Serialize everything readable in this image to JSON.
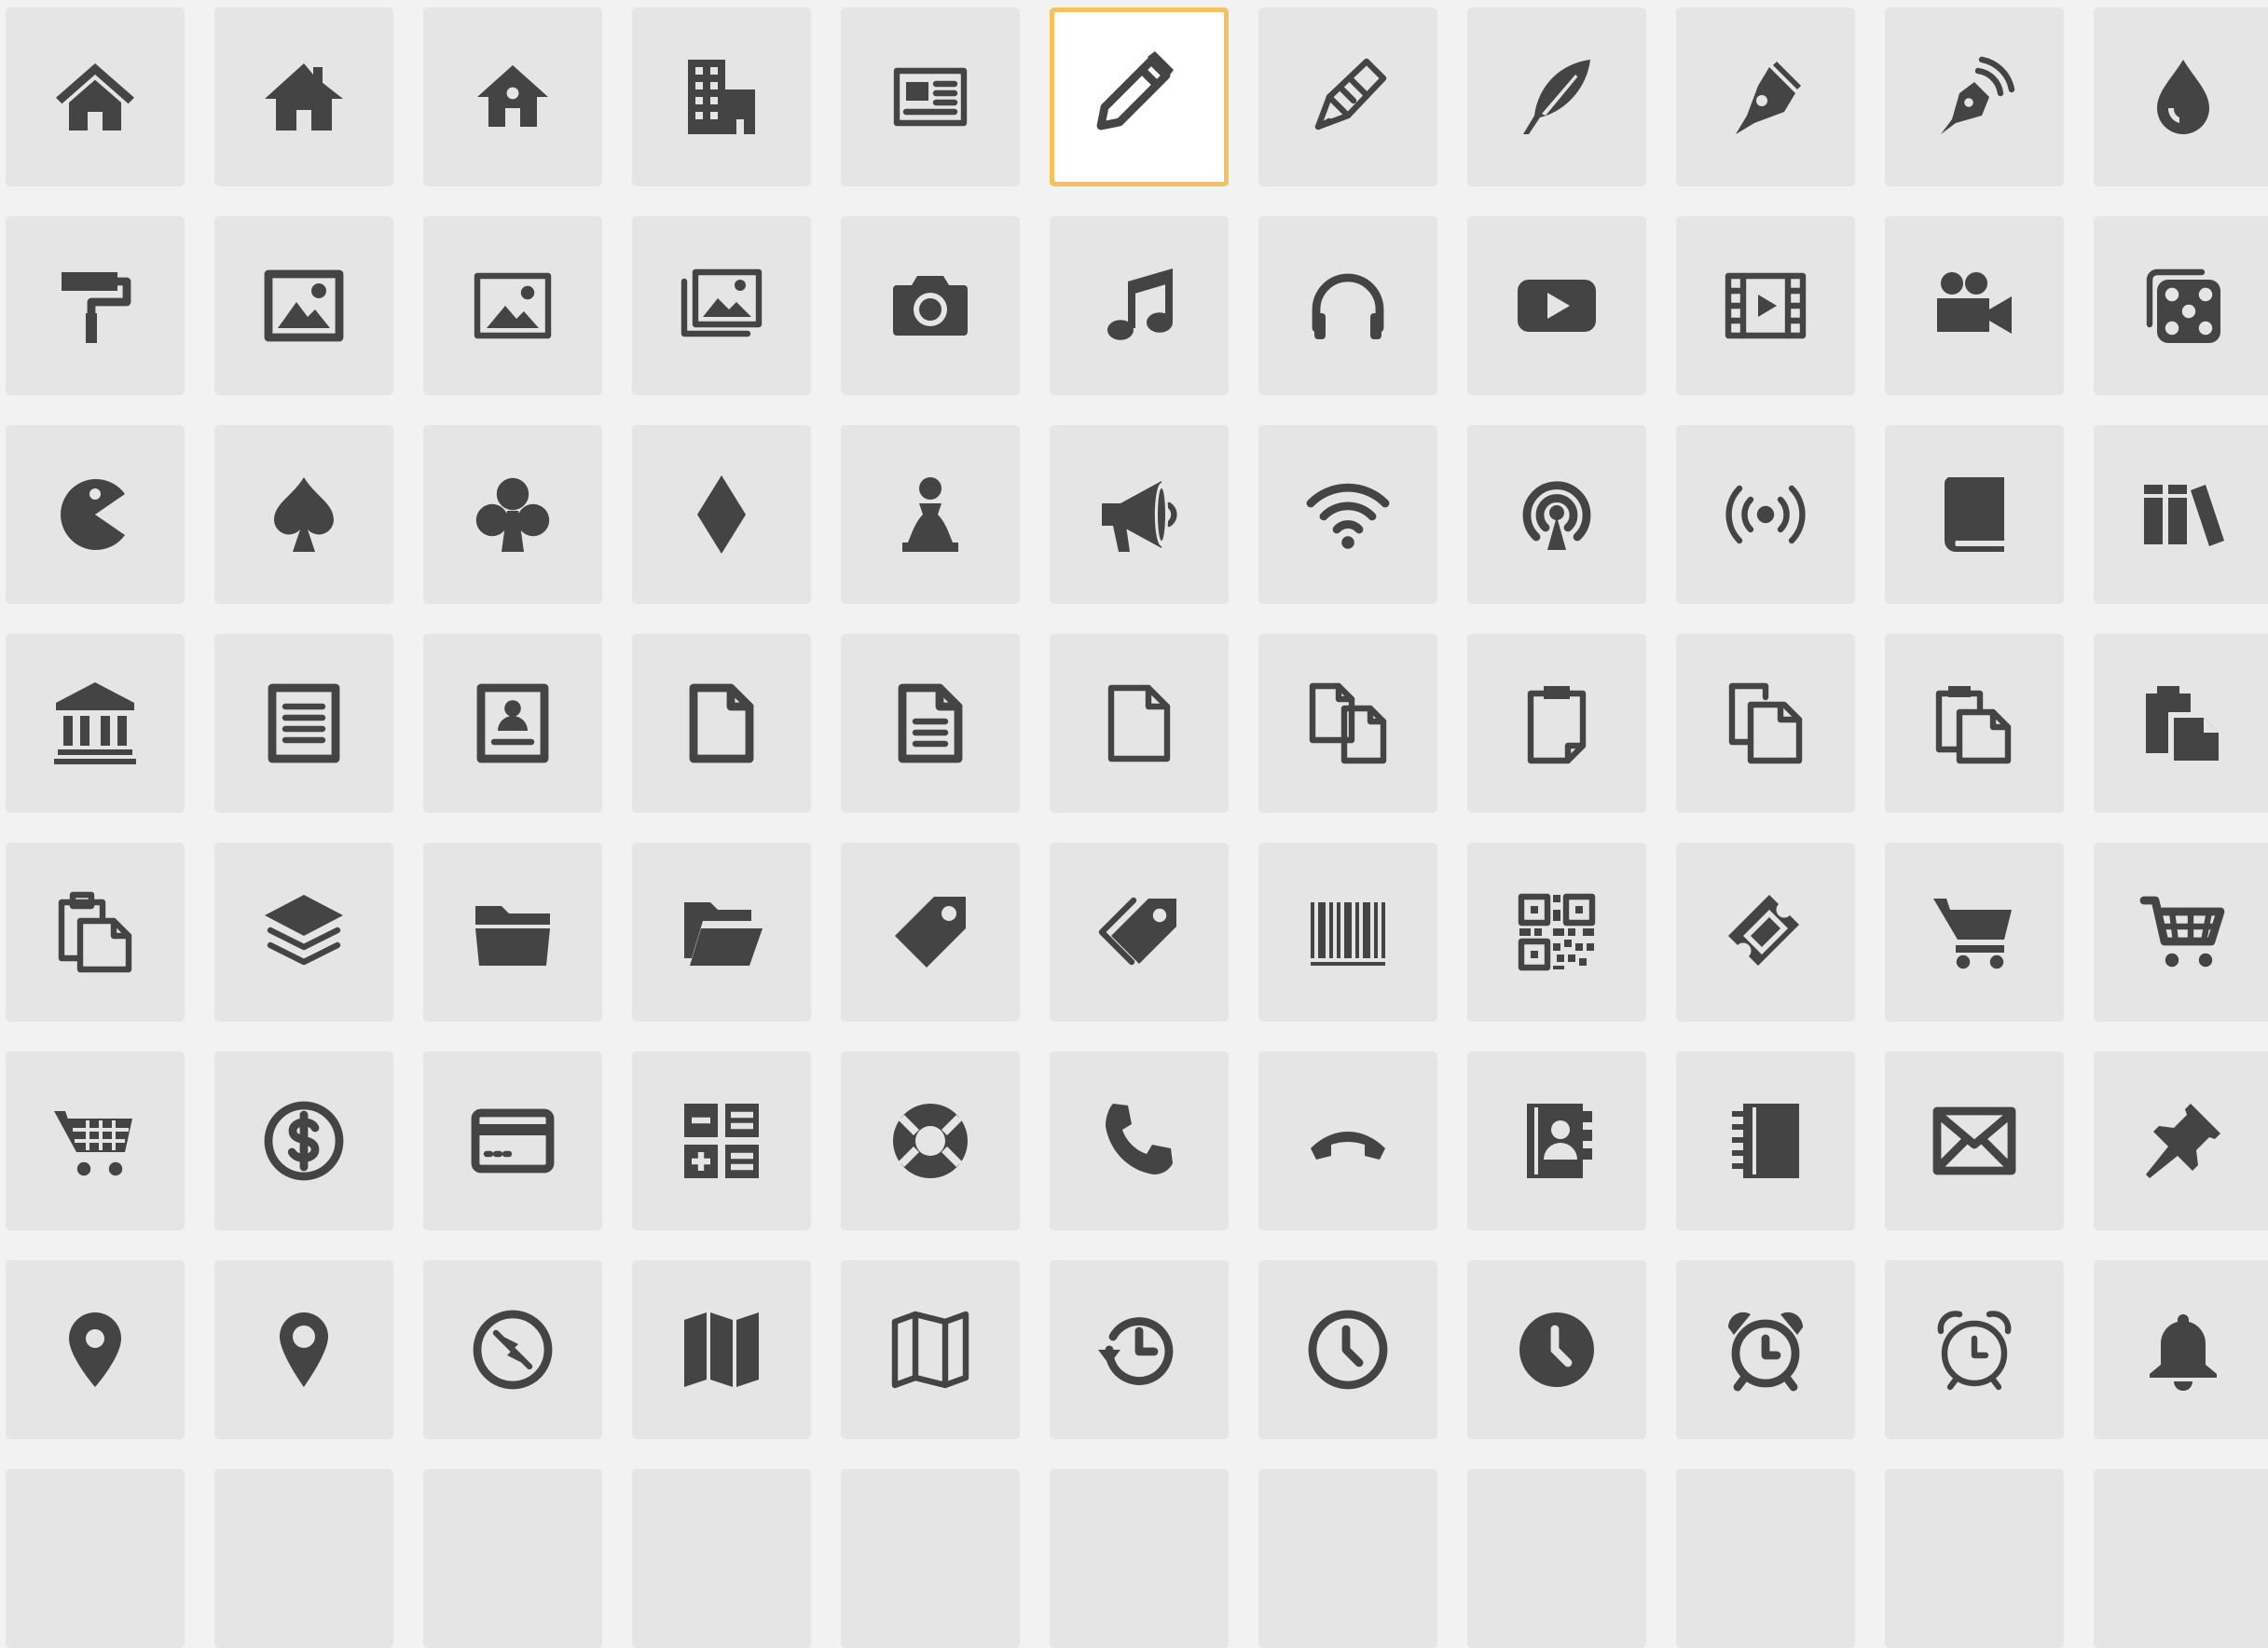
{
  "colors": {
    "page_background": "#f2f2f2",
    "tile_background": "#e5e5e5",
    "icon": "#444444",
    "selected_border": "#f6c25e"
  },
  "selected_icon": "pencil-icon",
  "icons": [
    [
      "home-icon",
      "home-solid-icon",
      "home-small-icon",
      "office-icon",
      "newspaper-icon",
      "pencil-icon",
      "quill-pencil-icon",
      "feather-icon",
      "pen-icon",
      "blog-icon",
      "droplet-icon"
    ],
    [
      "paint-roller-icon",
      "image-icon",
      "image-outline-icon",
      "images-icon",
      "camera-icon",
      "music-icon",
      "headphones-icon",
      "play-icon",
      "film-icon",
      "video-camera-icon",
      "dice-icon"
    ],
    [
      "pacman-icon",
      "spades-icon",
      "clubs-icon",
      "diamonds-icon",
      "pawn-icon",
      "bullhorn-icon",
      "wifi-icon",
      "podcast-icon",
      "feed-icon",
      "book-icon",
      "books-icon"
    ],
    [
      "library-icon",
      "file-text-icon",
      "profile-icon",
      "file-empty-icon",
      "file-text2-icon",
      "file-outline-icon",
      "files-empty-icon",
      "clipboard-file-icon",
      "copy-icon",
      "paste-icon",
      "paste-solid-icon"
    ],
    [
      "paste-outline-icon",
      "stack-icon",
      "folder-icon",
      "folder-open-icon",
      "price-tag-icon",
      "price-tags-icon",
      "barcode-icon",
      "qrcode-icon",
      "ticket-icon",
      "cart-icon",
      "cart-outline-icon"
    ],
    [
      "shopping-basket-icon",
      "coin-dollar-icon",
      "credit-card-icon",
      "calculator-icon",
      "lifebuoy-icon",
      "phone-icon",
      "phone-hang-up-icon",
      "address-book-icon",
      "notebook-icon",
      "envelop-icon",
      "pushpin-icon"
    ],
    [
      "location-icon",
      "location2-icon",
      "compass-icon",
      "map-icon",
      "map-outline-icon",
      "history-icon",
      "clock-icon",
      "clock-solid-icon",
      "alarm-icon",
      "alarm-outline-icon",
      "bell-icon"
    ],
    [
      "icon",
      "icon",
      "icon",
      "icon",
      "icon",
      "icon",
      "icon",
      "icon",
      "icon",
      "icon",
      "icon"
    ]
  ]
}
